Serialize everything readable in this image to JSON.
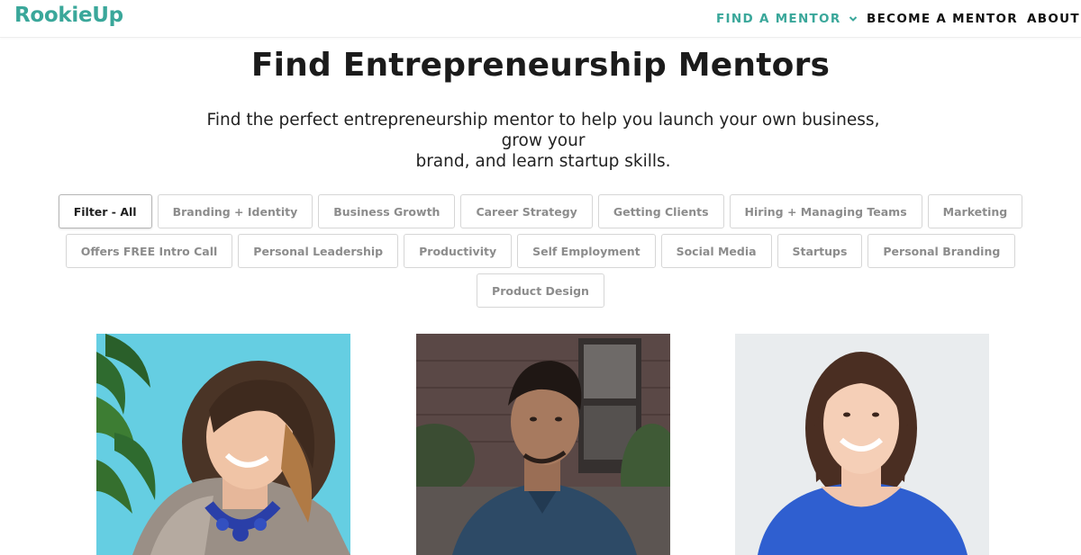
{
  "header": {
    "logo": "RookieUp",
    "nav": {
      "find_mentor": "FIND A MENTOR",
      "become_mentor": "BECOME A MENTOR",
      "about": "ABOUT"
    },
    "accent_color": "#3aa79a"
  },
  "main": {
    "title": "Find Entrepreneurship Mentors",
    "subtitle_line1": "Find the perfect entrepreneurship mentor to help you launch your own business, grow your",
    "subtitle_line2": "brand, and learn startup skills."
  },
  "filters": {
    "row1": [
      "Filter - All",
      "Branding + Identity",
      "Business Growth",
      "Career Strategy",
      "Getting Clients",
      "Hiring + Managing Teams",
      "Marketing"
    ],
    "row2": [
      "Offers FREE Intro Call",
      "Personal Leadership",
      "Productivity",
      "Self Employment",
      "Social Media",
      "Startups",
      "Personal Branding"
    ],
    "row3": [
      "Product Design"
    ],
    "selected": "Filter - All"
  },
  "mentors": [
    {
      "photo": "mentor-photo-woman-teal-background"
    },
    {
      "photo": "mentor-photo-man-brick-background"
    },
    {
      "photo": "mentor-photo-woman-white-background"
    }
  ]
}
